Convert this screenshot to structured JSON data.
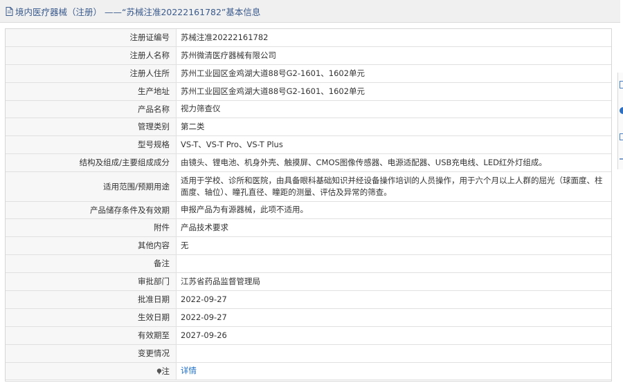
{
  "header": {
    "title": "境内医疗器械（注册） ——“苏械注准20222161782”基本信息",
    "icon": "document-icon"
  },
  "rows": [
    {
      "label": "注册证编号",
      "value": "苏械注准20222161782"
    },
    {
      "label": "注册人名称",
      "value": "苏州微清医疗器械有限公司"
    },
    {
      "label": "注册人住所",
      "value": "苏州工业园区金鸡湖大道88号G2-1601、1602单元"
    },
    {
      "label": "生产地址",
      "value": "苏州工业园区金鸡湖大道88号G2-1601、1602单元"
    },
    {
      "label": "产品名称",
      "value": "视力筛查仪"
    },
    {
      "label": "管理类别",
      "value": "第二类"
    },
    {
      "label": "型号规格",
      "value": "VS-T、VS-T Pro、VS-T Plus"
    },
    {
      "label": "结构及组成/主要组成成分",
      "value": "由镜头、锂电池、机身外壳、触摸屏、CMOS图像传感器、电源适配器、USB充电线、LED红外灯组成。"
    },
    {
      "label": "适用范围/预期用途",
      "value": "适用于学校、诊所和医院，由具备眼科基础知识并经设备操作培训的人员操作，用于六个月以上人群的屈光（球面度、柱面度、轴位）、瞳孔直径、瞳距的测量、评估及异常的筛查。"
    },
    {
      "label": "产品储存条件及有效期",
      "value": "申报产品为有源器械，此项不适用。"
    },
    {
      "label": "附件",
      "value": "产品技术要求"
    },
    {
      "label": "其他内容",
      "value": "无"
    },
    {
      "label": "备注",
      "value": ""
    },
    {
      "label": "审批部门",
      "value": "江苏省药品监督管理局"
    },
    {
      "label": "批准日期",
      "value": "2022-09-27"
    },
    {
      "label": "生效日期",
      "value": "2022-09-27"
    },
    {
      "label": "有效期至",
      "value": "2027-09-26"
    },
    {
      "label": "变更情况",
      "value": ""
    }
  ],
  "note_row": {
    "label": "注",
    "link_text": "详情",
    "icon": "pin-icon"
  },
  "colors": {
    "header_text": "#3a5a8c",
    "link": "#1e6fc7",
    "label_bg": "#f7f7f7"
  }
}
